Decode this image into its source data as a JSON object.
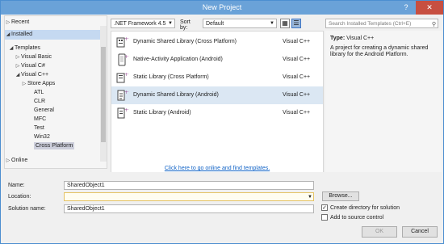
{
  "window": {
    "title": "New Project",
    "help_symbol": "?",
    "close_symbol": "✕"
  },
  "sidebar": {
    "recent": "Recent",
    "installed": "Installed",
    "templates": "Templates",
    "visual_basic": "Visual Basic",
    "visual_csharp": "Visual C#",
    "visual_cpp": "Visual C++",
    "store_apps": "Store Apps",
    "cpp_items": [
      "ATL",
      "CLR",
      "General",
      "MFC",
      "Test",
      "Win32",
      "Cross Platform"
    ],
    "online": "Online"
  },
  "toolbar": {
    "framework": ".NET Framework 4.5",
    "sort_label": "Sort by:",
    "sort_value": "Default",
    "search_placeholder": "Search Installed Templates (Ctrl+E)"
  },
  "templates": [
    {
      "name": "Dynamic Shared Library (Cross Platform)",
      "lang": "Visual C++",
      "icon": "cross-platform-library-icon"
    },
    {
      "name": "Native-Activity Application (Android)",
      "lang": "Visual C++",
      "icon": "android-app-icon"
    },
    {
      "name": "Static Library (Cross Platform)",
      "lang": "Visual C++",
      "icon": "static-library-icon"
    },
    {
      "name": "Dynamic Shared Library (Android)",
      "lang": "Visual C++",
      "icon": "android-library-icon"
    },
    {
      "name": "Static Library (Android)",
      "lang": "Visual C++",
      "icon": "android-static-library-icon"
    }
  ],
  "online_link": "Click here to go online and find templates.",
  "details": {
    "type_label": "Type:",
    "type_value": "Visual C++",
    "description": "A project for creating a dynamic shared library for the Android Platform."
  },
  "form": {
    "name_label": "Name:",
    "name_value": "SharedObject1",
    "location_label": "Location:",
    "location_value": "",
    "solution_label": "Solution name:",
    "solution_value": "SharedObject1",
    "browse": "Browse...",
    "create_dir": "Create directory for solution",
    "create_dir_checked": true,
    "add_source": "Add to source control",
    "add_source_checked": false,
    "ok": "OK",
    "cancel": "Cancel"
  }
}
